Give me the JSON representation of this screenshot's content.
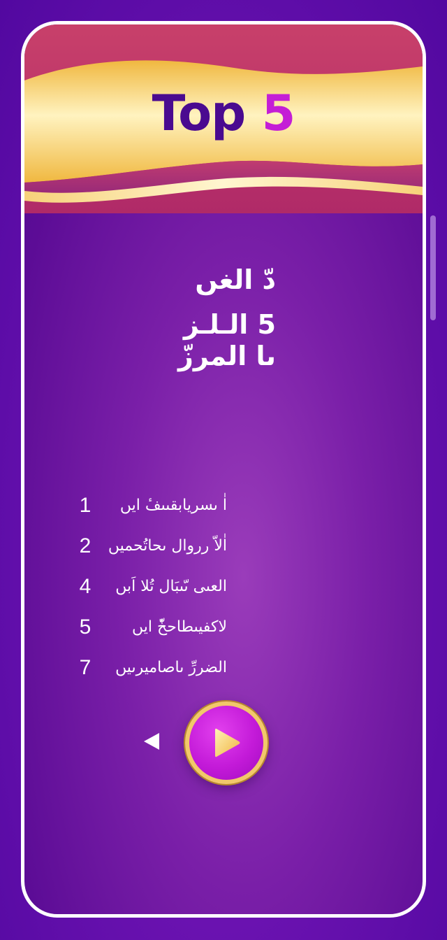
{
  "header": {
    "title_word": "Top",
    "title_number": "5"
  },
  "headline": {
    "line1": "دّ الغں",
    "line2": "5 الـلـز",
    "line3": "ںا المرزّ"
  },
  "list": {
    "items": [
      {
        "number": "1",
        "text": "اٰ ںسریابقںںفٔ ایں"
      },
      {
        "number": "2",
        "text": "اٰلاّ رروال ںحاتُحمیں"
      },
      {
        "number": "4",
        "text": "العںی ںّںبَال تُلا اَبں"
      },
      {
        "number": "5",
        "text": "لاکفیںطاحخّٔ ایں"
      },
      {
        "number": "7",
        "text": "الضررِّ ںاصامیرںیں"
      }
    ]
  },
  "controls": {
    "prev_icon": "triangle-left-icon",
    "play_icon": "play-icon"
  },
  "colors": {
    "background": "#5a0aa0",
    "card_border": "#ffffff",
    "title_word": "#4a0a90",
    "title_number": "#c41ed6",
    "banner_gold": "#f2c86a",
    "banner_magenta": "#c8406a",
    "play_button": "#c31ad8"
  }
}
